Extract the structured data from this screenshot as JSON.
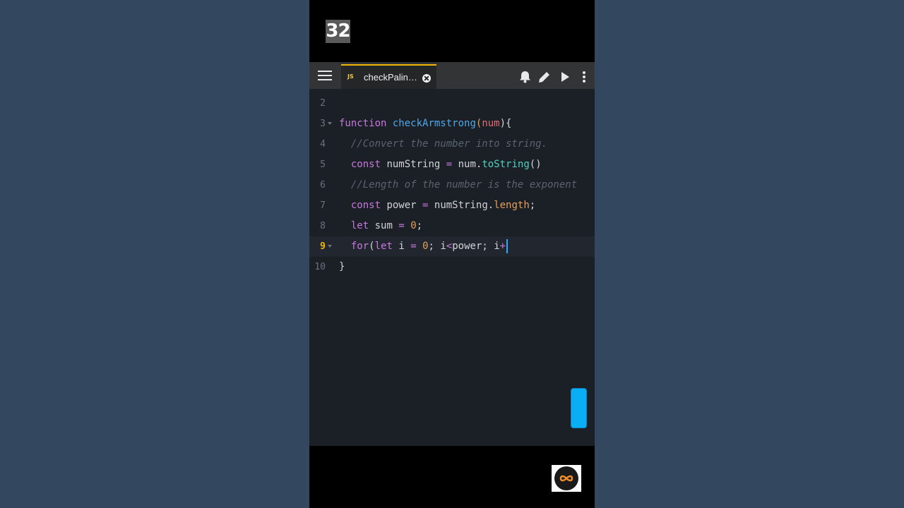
{
  "video": {
    "counter": "32"
  },
  "toolbar": {
    "tab_icon": "JS",
    "tab_label": "checkPalin…",
    "icons": [
      "menu-icon",
      "close-icon",
      "bell-icon",
      "pencil-icon",
      "play-icon",
      "more-vertical-icon"
    ]
  },
  "editor": {
    "lines": [
      {
        "num": "2",
        "fold": false,
        "tokens": []
      },
      {
        "num": "3",
        "fold": true,
        "tokens": [
          {
            "t": "function",
            "c": "kw"
          },
          {
            "t": " ",
            "c": ""
          },
          {
            "t": "checkArmstrong",
            "c": "fn"
          },
          {
            "t": "(",
            "c": "pr"
          },
          {
            "t": "num",
            "c": "pm"
          },
          {
            "t": "){",
            "c": ""
          }
        ]
      },
      {
        "num": "4",
        "fold": false,
        "tokens": [
          {
            "t": "  ",
            "c": ""
          },
          {
            "t": "//Convert the number into string.",
            "c": "cm"
          }
        ]
      },
      {
        "num": "5",
        "fold": false,
        "tokens": [
          {
            "t": "  ",
            "c": ""
          },
          {
            "t": "const",
            "c": "kw"
          },
          {
            "t": " numString ",
            "c": ""
          },
          {
            "t": "=",
            "c": "op"
          },
          {
            "t": " num.",
            "c": ""
          },
          {
            "t": "toString",
            "c": "mt"
          },
          {
            "t": "()",
            "c": ""
          }
        ]
      },
      {
        "num": "6",
        "fold": false,
        "tokens": [
          {
            "t": "  ",
            "c": ""
          },
          {
            "t": "//Length of the number is the exponent",
            "c": "cm"
          }
        ]
      },
      {
        "num": "7",
        "fold": false,
        "tokens": [
          {
            "t": "  ",
            "c": ""
          },
          {
            "t": "const",
            "c": "kw"
          },
          {
            "t": " power ",
            "c": ""
          },
          {
            "t": "=",
            "c": "op"
          },
          {
            "t": " numString.",
            "c": ""
          },
          {
            "t": "length",
            "c": "nm"
          },
          {
            "t": ";",
            "c": ""
          }
        ]
      },
      {
        "num": "8",
        "fold": false,
        "tokens": [
          {
            "t": "  ",
            "c": ""
          },
          {
            "t": "let",
            "c": "kw"
          },
          {
            "t": " sum ",
            "c": ""
          },
          {
            "t": "=",
            "c": "op"
          },
          {
            "t": " ",
            "c": ""
          },
          {
            "t": "0",
            "c": "nm"
          },
          {
            "t": ";",
            "c": ""
          }
        ]
      },
      {
        "num": "9",
        "fold": true,
        "active": true,
        "caret": true,
        "tokens": [
          {
            "t": "  ",
            "c": ""
          },
          {
            "t": "for",
            "c": "kw"
          },
          {
            "t": "(",
            "c": ""
          },
          {
            "t": "let",
            "c": "kw"
          },
          {
            "t": " i ",
            "c": ""
          },
          {
            "t": "=",
            "c": "op"
          },
          {
            "t": " ",
            "c": ""
          },
          {
            "t": "0",
            "c": "nm"
          },
          {
            "t": "; i",
            "c": ""
          },
          {
            "t": "<",
            "c": "op"
          },
          {
            "t": "power; i",
            "c": ""
          },
          {
            "t": "+",
            "c": "op"
          }
        ]
      },
      {
        "num": "10",
        "fold": false,
        "tokens": [
          {
            "t": "}",
            "c": ""
          }
        ]
      }
    ]
  },
  "colors": {
    "background": "#33485f",
    "toolbar": "#333436",
    "editor": "#1b1f26",
    "accent": "#f2b705",
    "scroll_handle": "#0aaef5"
  }
}
